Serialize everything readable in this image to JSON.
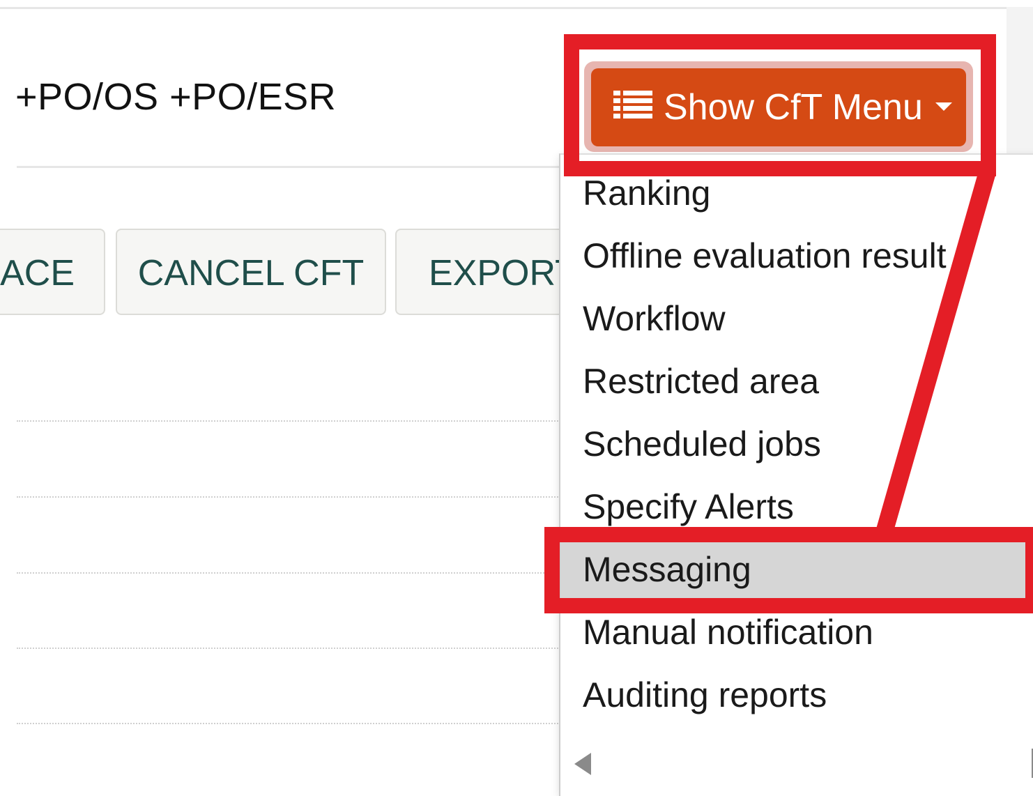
{
  "page": {
    "title": "+PO/OS +PO/ESR"
  },
  "actions": [
    {
      "label": "ACE"
    },
    {
      "label": "CANCEL CFT"
    },
    {
      "label": "EXPORT"
    }
  ],
  "menu_button": {
    "label": "Show CfT Menu",
    "icon": "list-icon",
    "caret_icon": "caret-down-icon",
    "color": "#d54a14"
  },
  "dropdown": {
    "items": [
      {
        "label": "Ranking"
      },
      {
        "label": "Offline evaluation result"
      },
      {
        "label": "Workflow"
      },
      {
        "label": "Restricted area"
      },
      {
        "label": "Scheduled jobs"
      },
      {
        "label": "Specify Alerts"
      },
      {
        "label": "Messaging",
        "highlighted": true
      },
      {
        "label": "Manual notification"
      },
      {
        "label": "Auditing reports"
      }
    ],
    "scroll_icon": "scroll-left-icon"
  },
  "annotation": {
    "color": "#e41e26"
  }
}
